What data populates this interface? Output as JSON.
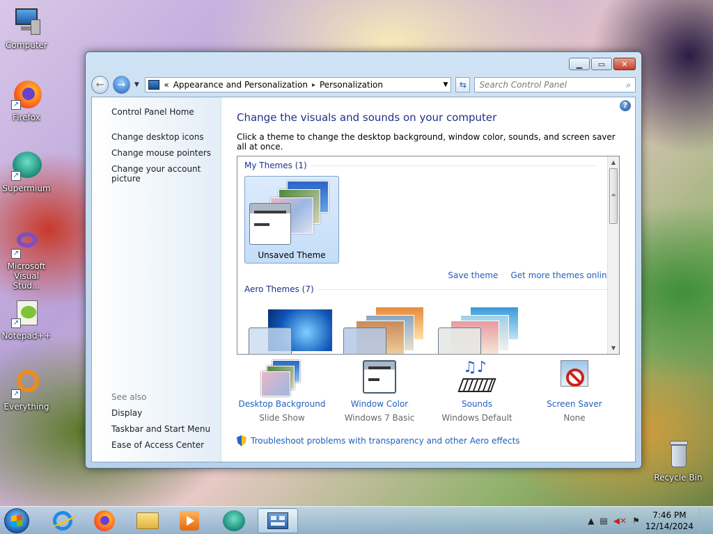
{
  "desktop": {
    "icons": [
      {
        "label": "Computer"
      },
      {
        "label": "Firefox"
      },
      {
        "label": "Supermium"
      },
      {
        "label": "Microsoft Visual Stud..."
      },
      {
        "label": "Notepad++"
      },
      {
        "label": "Everything"
      },
      {
        "label": "Recycle Bin"
      }
    ]
  },
  "window": {
    "address": {
      "chevrons": "«",
      "crumbs": [
        "Appearance and Personalization",
        "Personalization"
      ],
      "separator": "▸"
    },
    "search": {
      "placeholder": "Search Control Panel"
    },
    "left_pane": {
      "home": "Control Panel Home",
      "links": [
        "Change desktop icons",
        "Change mouse pointers",
        "Change your account picture"
      ],
      "see_also_header": "See also",
      "see_also": [
        "Display",
        "Taskbar and Start Menu",
        "Ease of Access Center"
      ]
    },
    "main": {
      "title": "Change the visuals and sounds on your computer",
      "description": "Click a theme to change the desktop background, window color, sounds, and screen saver all at once.",
      "my_themes_header": "My Themes (1)",
      "unsaved_theme_label": "Unsaved Theme",
      "save_theme": "Save theme",
      "get_more": "Get more themes online",
      "aero_themes_header": "Aero Themes (7)",
      "settings": [
        {
          "name": "Desktop Background",
          "value": "Slide Show"
        },
        {
          "name": "Window Color",
          "value": "Windows 7 Basic"
        },
        {
          "name": "Sounds",
          "value": "Windows Default"
        },
        {
          "name": "Screen Saver",
          "value": "None"
        }
      ],
      "troubleshoot": "Troubleshoot problems with transparency and other Aero effects",
      "help": "?"
    }
  },
  "taskbar": {
    "clock_time": "7:46 PM",
    "clock_date": "12/14/2024"
  }
}
